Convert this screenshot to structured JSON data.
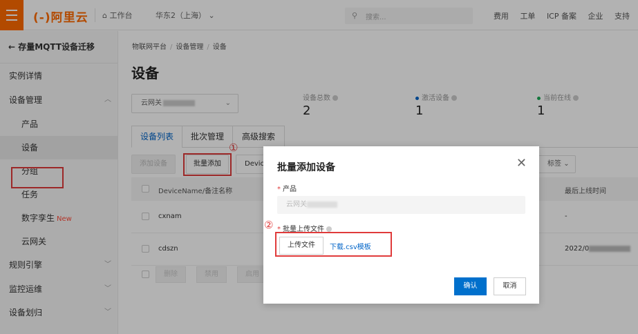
{
  "topbar": {
    "logo": "(-)阿里云",
    "workbench": "工作台",
    "region": "华东2（上海）",
    "search_placeholder": "搜索...",
    "links": [
      "费用",
      "工单",
      "ICP 备案",
      "企业",
      "支持"
    ],
    "accent": "#ff6a00"
  },
  "sidebar": {
    "back_title": "← 存量MQTT设备迁移",
    "items": [
      {
        "label": "实例详情"
      },
      {
        "label": "设备管理"
      },
      {
        "label": "产品"
      },
      {
        "label": "设备"
      },
      {
        "label": "分组"
      },
      {
        "label": "任务"
      },
      {
        "label": "数字孪生",
        "badge": "New"
      },
      {
        "label": "云网关"
      },
      {
        "label": "规则引擎"
      },
      {
        "label": "监控运维"
      },
      {
        "label": "设备划归"
      }
    ]
  },
  "main": {
    "breadcrumb": [
      "物联网平台",
      "设备管理",
      "设备"
    ],
    "title": "设备",
    "product_select": "云网关",
    "stats": [
      {
        "label": "设备总数",
        "value": "2"
      },
      {
        "label": "激活设备",
        "value": "1",
        "color": "#0064c8"
      },
      {
        "label": "当前在线",
        "value": "1",
        "color": "#1aaa55"
      }
    ],
    "tabs": [
      "设备列表",
      "批次管理",
      "高级搜索"
    ],
    "toolbar": {
      "add": "添加设备",
      "batch_add": "批量添加",
      "device_filter": "Devic",
      "tag": "标签"
    },
    "table": {
      "col_name": "DeviceName/备注名称",
      "col_last_online": "最后上线时间",
      "rows": [
        {
          "name": "cxnam",
          "last_online": "-"
        },
        {
          "name": "cdszn",
          "last_online": "2022/0"
        }
      ]
    },
    "footer_buttons": [
      "删除",
      "禁用",
      "启用"
    ]
  },
  "annotations": {
    "step1": "①",
    "step2": "②"
  },
  "modal": {
    "title": "批量添加设备",
    "product_label": "产品",
    "product_value": "云网关",
    "upload_label": "批量上传文件",
    "upload_button": "上传文件",
    "download_link": "下载.csv模板",
    "ok": "确认",
    "cancel": "取消"
  }
}
